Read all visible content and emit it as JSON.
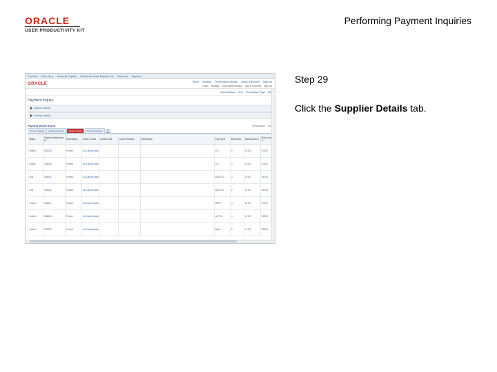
{
  "logo": {
    "word": "ORACLE",
    "sub": "USER PRODUCTIVITY KIT"
  },
  "doc_title": "Performing Payment Inquiries",
  "step": "Step 29",
  "instruction": {
    "prefix": "Click the ",
    "bold": "Supplier Details",
    "suffix": " tab."
  },
  "screenshot": {
    "topbar": [
      "Favorites",
      "Main Menu",
      "Accounts Payable",
      "Review Accounts Payable Info",
      "Payments",
      "Payment"
    ],
    "oracle_word": "ORACLE",
    "header_links": [
      "Home",
      "Worklist",
      "Performance Monitor",
      "Add to Favorites",
      "Sign out"
    ],
    "header_sub_links": [
      "Home",
      "Worklist",
      "Performance Monitor",
      "Add to Favorites",
      "Sign out"
    ],
    "subbar_links": [
      "New Window",
      "Help",
      "Personalize Page",
      "http"
    ],
    "page_title": "Payment Inquiry",
    "sections": [
      "Search Criteria",
      "Sorting Criteria"
    ],
    "grid_title": "Payment Inquiry Result",
    "grid_right": [
      "Personalize",
      "Find"
    ],
    "tabs": [
      {
        "label": "Payment Details",
        "active": false
      },
      {
        "label": "Additional Details",
        "active": false
      },
      {
        "label": "Supplier Details",
        "active": true
      },
      {
        "label": "Financial Gateway",
        "active": false
      }
    ],
    "columns": [
      "Status",
      "Payment Reference ID",
      "Paid Status",
      "Action Codes",
      "Cancel Date",
      "Cancel Reason",
      "Description",
      "Pay Cycle",
      "Data Row",
      "Bank Account",
      "Bank Acct #"
    ],
    "rows": [
      [
        "Voided",
        "333044",
        "Posted",
        "Un-Cancel Action",
        "",
        "",
        "",
        "111",
        "2",
        "CHKS",
        "97452"
      ],
      [
        "Voided",
        "333045",
        "Posted",
        "Un-Cancel Action",
        "",
        "",
        "",
        "111",
        "2",
        "CHKS",
        "97452"
      ],
      [
        "Void",
        "333031",
        "Posted",
        "Un-Cancel Action",
        "",
        "",
        "",
        "DAILY02",
        "3",
        "CHK1",
        "98763"
      ],
      [
        "Void",
        "333031",
        "Posted",
        "Un-Cancel Action",
        "",
        "",
        "",
        "DAILY02",
        "2",
        "CHK1",
        "98763"
      ],
      [
        "Voided",
        "333021",
        "Posted",
        "Un-Cancel Action",
        "",
        "",
        "",
        "WKPT",
        "4",
        "CHKS",
        "97452"
      ],
      [
        "Voided",
        "333023",
        "Posted",
        "Un-Cancel Action",
        "",
        "",
        "",
        "AUTO1",
        "4",
        "CHKS",
        "98953"
      ],
      [
        "Voided",
        "333024",
        "Posted",
        "Un-Cancel Action",
        "",
        "",
        "",
        "Daily",
        "2",
        "CHKS",
        "98963"
      ]
    ]
  }
}
